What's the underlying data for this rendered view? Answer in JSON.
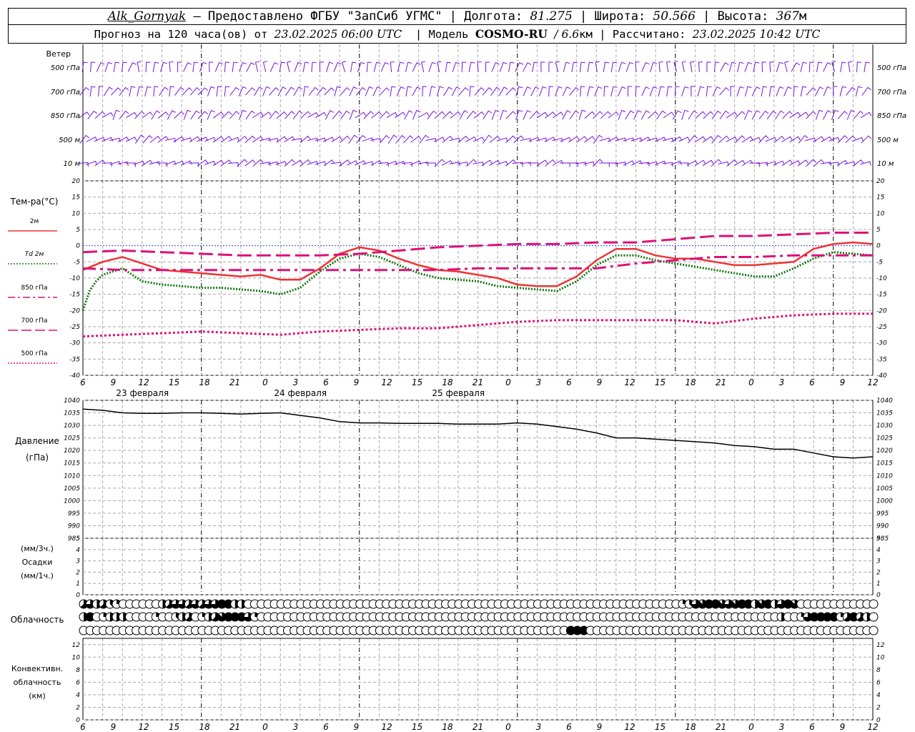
{
  "header": {
    "station": "Alk_Gornyak",
    "provided": "– Предоставлено ФГБУ \"ЗапСиб УГМС\" |",
    "lon_label": "Долгота:",
    "lon_value": "81.275",
    "lat_label": "| Широта:",
    "lat_value": "50.566",
    "alt_label": "| Высота:",
    "alt_value": "367",
    "alt_unit": "м",
    "forecast_label": "Прогноз на 120 часа(ов) от",
    "forecast_start": "23.02.2025 06:00 UTC",
    "model_label": "| Модель",
    "model_name": "COSMO-RU",
    "model_res": "/ 6.6",
    "model_res_unit": "км",
    "computed_label": "| Рассчитано:",
    "computed_at": "23.02.2025 10:42 UTC"
  },
  "labels": {
    "wind": "Ветер",
    "temp": "Тем-ра(°C)",
    "pressure": "Давление",
    "pressure_unit": "(гПа)",
    "precip_1": "(мм/3ч.)",
    "precip_2": "Осадки",
    "precip_3": "(мм/1ч.)",
    "cloud": "Облачность",
    "conv_1": "Конвективн.",
    "conv_2": "облачность",
    "conv_3": "(км)",
    "wind_levels": [
      "500 гПа",
      "700 гПа",
      "850 гПа",
      "500 м",
      "10 м"
    ],
    "legend": [
      {
        "name": "2м",
        "color": "#ee3333",
        "dash": "solid"
      },
      {
        "name": "Td 2м",
        "color": "#117711",
        "dash": "dotted"
      },
      {
        "name": "850 гПа",
        "color": "#dd1177",
        "dash": "dash-dot"
      },
      {
        "name": "700 гПа",
        "color": "#dd1177",
        "dash": "long-dash"
      },
      {
        "name": "500 гПа",
        "color": "#dd1177",
        "dash": "dotted"
      }
    ],
    "days": [
      "23 февраля",
      "24 февраля",
      "25 февраля"
    ]
  },
  "time_ticks": [
    "6",
    "9",
    "12",
    "15",
    "18",
    "21",
    "0",
    "3",
    "6",
    "9",
    "12",
    "15",
    "18",
    "21",
    "0",
    "3",
    "6",
    "9",
    "12",
    "15",
    "18",
    "21",
    "0",
    "3",
    "6",
    "9",
    "12"
  ],
  "colors": {
    "wind": "#7711dd",
    "temp2m": "#ee3333",
    "td": "#117711",
    "upper": "#dd1177",
    "pressure": "#000000",
    "grid": "#999999"
  },
  "chart_data": [
    {
      "type": "line",
      "title": "Тем-ра(°C)",
      "x_unit": "hours since 23.02.2025 06:00 UTC",
      "ylim": [
        -40,
        20
      ],
      "yticks": [
        20,
        15,
        10,
        5,
        0,
        -5,
        -10,
        -15,
        -20,
        -25,
        -30,
        -35,
        -40
      ],
      "series": [
        {
          "name": "2м",
          "x": [
            0,
            3,
            6,
            9,
            12,
            15,
            18,
            21,
            24,
            27,
            30,
            33,
            36,
            39,
            42,
            45,
            48,
            51,
            54,
            57,
            60,
            63,
            66,
            69,
            72,
            75,
            78,
            81,
            84,
            87,
            90,
            93,
            96,
            99,
            102,
            105,
            108,
            111,
            114,
            117,
            120
          ],
          "values": [
            -7.5,
            -5,
            -3.5,
            -5.5,
            -7.5,
            -8,
            -8.5,
            -9,
            -9.5,
            -9,
            -10.5,
            -10.5,
            -7,
            -2.5,
            -0.5,
            -1.5,
            -4,
            -6,
            -7.5,
            -8,
            -9,
            -10,
            -12,
            -12.5,
            -12.5,
            -9.5,
            -4.5,
            -1,
            -1,
            -3,
            -4,
            -4,
            -5,
            -6,
            -6,
            -5.5,
            -5,
            -1,
            0.5,
            1,
            0.5
          ]
        },
        {
          "name": "Td 2м",
          "x": [
            0,
            1,
            2,
            3,
            6,
            9,
            12,
            15,
            18,
            21,
            24,
            27,
            30,
            33,
            36,
            39,
            42,
            45,
            48,
            51,
            54,
            57,
            60,
            63,
            66,
            69,
            72,
            75,
            78,
            81,
            84,
            87,
            90,
            93,
            96,
            99,
            102,
            105,
            108,
            111,
            114,
            117,
            120
          ],
          "values": [
            -20,
            -14,
            -11,
            -9,
            -7,
            -11,
            -12,
            -12.5,
            -13,
            -13,
            -13.5,
            -14,
            -15,
            -13,
            -8,
            -4,
            -2.5,
            -3.5,
            -6,
            -8.5,
            -10,
            -10.5,
            -11,
            -12.5,
            -13,
            -13.5,
            -14,
            -11,
            -6,
            -3,
            -3,
            -4.5,
            -5.5,
            -6.5,
            -7.5,
            -8.5,
            -9.5,
            -9.5,
            -7,
            -4,
            -2,
            -2.5,
            -3
          ]
        },
        {
          "name": "850 гПа",
          "x": [
            0,
            6,
            12,
            18,
            24,
            30,
            36,
            42,
            48,
            54,
            60,
            66,
            72,
            78,
            84,
            90,
            96,
            102,
            108,
            114,
            120
          ],
          "values": [
            -7,
            -7.5,
            -7.5,
            -7.5,
            -7.5,
            -7.5,
            -7.5,
            -7.5,
            -7.5,
            -7.5,
            -7,
            -7,
            -7,
            -7,
            -5.5,
            -4.5,
            -3.5,
            -3.5,
            -3,
            -3,
            -3
          ]
        },
        {
          "name": "700 гПа",
          "x": [
            0,
            6,
            12,
            18,
            24,
            30,
            36,
            42,
            48,
            54,
            60,
            66,
            72,
            78,
            84,
            90,
            96,
            102,
            108,
            114,
            120
          ],
          "values": [
            -2,
            -1.5,
            -2,
            -2.5,
            -3,
            -3,
            -3,
            -2.5,
            -1.5,
            -0.5,
            0,
            0.5,
            0.5,
            1,
            1,
            2,
            3,
            3,
            3.5,
            4,
            4
          ]
        },
        {
          "name": "500 гПа",
          "x": [
            0,
            6,
            12,
            18,
            24,
            30,
            36,
            42,
            48,
            54,
            60,
            66,
            72,
            78,
            84,
            90,
            96,
            102,
            108,
            114,
            120
          ],
          "values": [
            -28,
            -27.5,
            -27,
            -26.5,
            -27,
            -27.5,
            -26.5,
            -26,
            -25.5,
            -25.5,
            -24.5,
            -23.5,
            -23,
            -23,
            -23,
            -23,
            -24,
            -22.5,
            -21.5,
            -21,
            -21
          ]
        }
      ]
    },
    {
      "type": "line",
      "title": "Давление",
      "ylabel": "(гПа)",
      "ylim": [
        985,
        1040
      ],
      "yticks": [
        1040,
        1035,
        1030,
        1025,
        1020,
        1015,
        1010,
        1005,
        1000,
        995,
        990,
        985
      ],
      "series": [
        {
          "name": "Давление",
          "x": [
            0,
            3,
            6,
            9,
            12,
            15,
            18,
            21,
            24,
            27,
            30,
            33,
            36,
            39,
            42,
            45,
            48,
            51,
            54,
            57,
            60,
            63,
            66,
            69,
            72,
            75,
            78,
            81,
            84,
            87,
            90,
            93,
            96,
            99,
            102,
            105,
            108,
            111,
            114,
            117,
            120
          ],
          "values": [
            1036.5,
            1036,
            1035,
            1034.8,
            1034.8,
            1035,
            1035,
            1034.8,
            1034.5,
            1034.8,
            1035,
            1034,
            1033,
            1031.5,
            1031,
            1031,
            1030.8,
            1030.8,
            1030.8,
            1030.5,
            1030.5,
            1030.5,
            1031,
            1030.5,
            1029.5,
            1028.5,
            1027,
            1025,
            1025,
            1024.5,
            1024,
            1023.5,
            1023,
            1022,
            1021.5,
            1020.5,
            1020.5,
            1019,
            1017.5,
            1017,
            1017.5
          ]
        }
      ]
    },
    {
      "type": "bar",
      "title": "Осадки",
      "ylim": [
        0,
        5
      ],
      "yticks": [
        0,
        1,
        2,
        3,
        4,
        5
      ],
      "values": []
    },
    {
      "type": "heatmap",
      "title": "Облачность",
      "levels": [
        "upper",
        "middle",
        "lower"
      ],
      "x_step_hours": 1,
      "upper_octas": [
        5,
        6,
        4,
        5,
        3,
        2,
        0,
        0,
        0,
        0,
        0,
        0,
        4,
        5,
        6,
        6,
        5,
        6,
        5,
        6,
        6,
        8,
        8,
        4,
        4,
        0,
        0,
        0,
        0,
        0,
        0,
        0,
        0,
        0,
        0,
        0,
        0,
        0,
        0,
        0,
        0,
        0,
        0,
        0,
        0,
        0,
        0,
        0,
        0,
        0,
        0,
        0,
        0,
        0,
        0,
        0,
        0,
        0,
        0,
        0,
        0,
        0,
        0,
        0,
        0,
        0,
        0,
        0,
        0,
        0,
        0,
        0,
        0,
        0,
        0,
        0,
        0,
        0,
        0,
        0,
        0,
        0,
        0,
        0,
        0,
        0,
        0,
        0,
        0,
        0,
        0,
        2,
        3,
        6,
        7,
        8,
        8,
        7,
        6,
        7,
        8,
        8,
        4,
        7,
        8,
        4,
        6,
        8,
        7,
        0,
        0,
        0,
        0,
        0,
        0,
        0,
        0,
        0,
        0,
        0,
        0,
        6,
        3,
        4,
        5
      ],
      "middle_octas": [
        4,
        8,
        0,
        2,
        4,
        4,
        4,
        0,
        0,
        0,
        0,
        2,
        0,
        0,
        3,
        4,
        5,
        0,
        2,
        4,
        5,
        7,
        8,
        8,
        8,
        6,
        2,
        0,
        0,
        0,
        0,
        0,
        0,
        0,
        0,
        0,
        0,
        0,
        0,
        0,
        0,
        0,
        0,
        0,
        0,
        0,
        0,
        0,
        0,
        0,
        0,
        0,
        0,
        0,
        0,
        0,
        0,
        0,
        0,
        0,
        0,
        0,
        0,
        0,
        0,
        0,
        0,
        0,
        0,
        0,
        0,
        0,
        0,
        0,
        0,
        0,
        0,
        0,
        0,
        0,
        0,
        0,
        0,
        0,
        0,
        0,
        0,
        0,
        0,
        0,
        0,
        0,
        0,
        0,
        0,
        0,
        0,
        0,
        0,
        0,
        0,
        0,
        0,
        0,
        0,
        0,
        4,
        0,
        0,
        2,
        6,
        8,
        8,
        8,
        8,
        2,
        5,
        8,
        5,
        4,
        0,
        0,
        0,
        0,
        0,
        0,
        0
      ],
      "lower_octas": [
        0,
        0,
        0,
        0,
        0,
        0,
        0,
        0,
        0,
        0,
        0,
        0,
        0,
        0,
        0,
        0,
        0,
        0,
        0,
        0,
        0,
        0,
        0,
        0,
        0,
        0,
        0,
        0,
        0,
        0,
        0,
        0,
        0,
        0,
        0,
        0,
        0,
        0,
        0,
        0,
        0,
        0,
        0,
        0,
        0,
        0,
        0,
        0,
        0,
        0,
        0,
        0,
        0,
        0,
        0,
        0,
        0,
        0,
        0,
        0,
        0,
        0,
        0,
        0,
        0,
        0,
        0,
        0,
        0,
        0,
        0,
        0,
        0,
        0,
        8,
        8,
        8,
        0,
        0,
        0,
        0,
        0,
        0,
        0,
        0,
        0,
        0,
        0,
        0,
        0,
        0,
        0,
        0,
        0,
        0,
        0,
        0,
        0,
        0,
        0,
        0,
        0,
        0,
        0,
        0,
        0,
        0,
        0,
        0,
        0,
        0,
        0,
        0,
        0,
        0,
        0,
        0,
        0,
        0,
        0,
        0,
        0,
        0,
        0,
        0,
        0,
        0,
        0,
        0,
        0,
        0
      ]
    },
    {
      "type": "bar",
      "title": "Конвективн. облачность",
      "ylabel": "(км)",
      "ylim": [
        0,
        13
      ],
      "yticks": [
        12,
        10,
        8,
        6,
        4,
        2,
        0
      ],
      "values": []
    }
  ]
}
